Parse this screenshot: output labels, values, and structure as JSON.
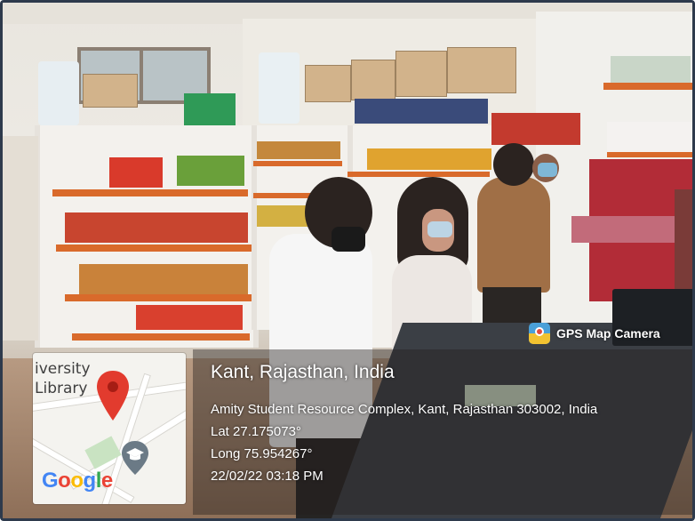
{
  "badge": {
    "label": "GPS Map Camera"
  },
  "location": {
    "title": "Kant, Rajasthan, India",
    "address": "Amity Student Resource Complex, Kant, Rajasthan 303002, India",
    "latitude": "Lat 27.175073°",
    "longitude": "Long 75.954267°",
    "datetime": "22/02/22 03:18 PM"
  },
  "map": {
    "label_line1": "iversity",
    "label_line2": "Library",
    "provider": [
      "G",
      "o",
      "o",
      "g",
      "l",
      "e"
    ],
    "provider_colors": [
      "#4285F4",
      "#EA4335",
      "#FBBC05",
      "#4285F4",
      "#34A853",
      "#EA4335"
    ],
    "pin_color": "#E23B2E",
    "icons": [
      "location-pin-icon",
      "graduation-cap-icon"
    ]
  },
  "colors": {
    "frame": "#2e3a4c",
    "shelf_accent": "#d96a2b"
  }
}
